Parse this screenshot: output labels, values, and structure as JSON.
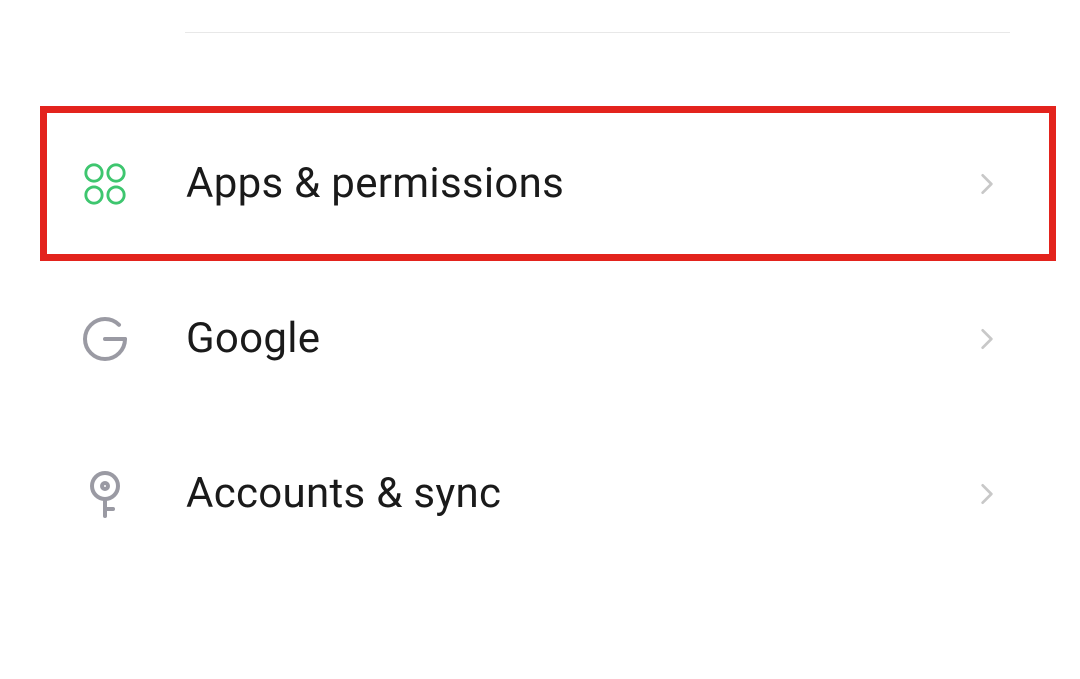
{
  "settings": {
    "items": [
      {
        "label": "Apps & permissions",
        "icon": "apps-icon",
        "highlighted": true
      },
      {
        "label": "Google",
        "icon": "google-icon",
        "highlighted": false
      },
      {
        "label": "Accounts & sync",
        "icon": "key-icon",
        "highlighted": false
      }
    ]
  },
  "colors": {
    "apps_icon": "#3ec66f",
    "google_icon": "#9a9aa3",
    "key_icon": "#9a9aa3",
    "chevron": "#c8c8c8",
    "highlight_border": "#e3231d"
  }
}
